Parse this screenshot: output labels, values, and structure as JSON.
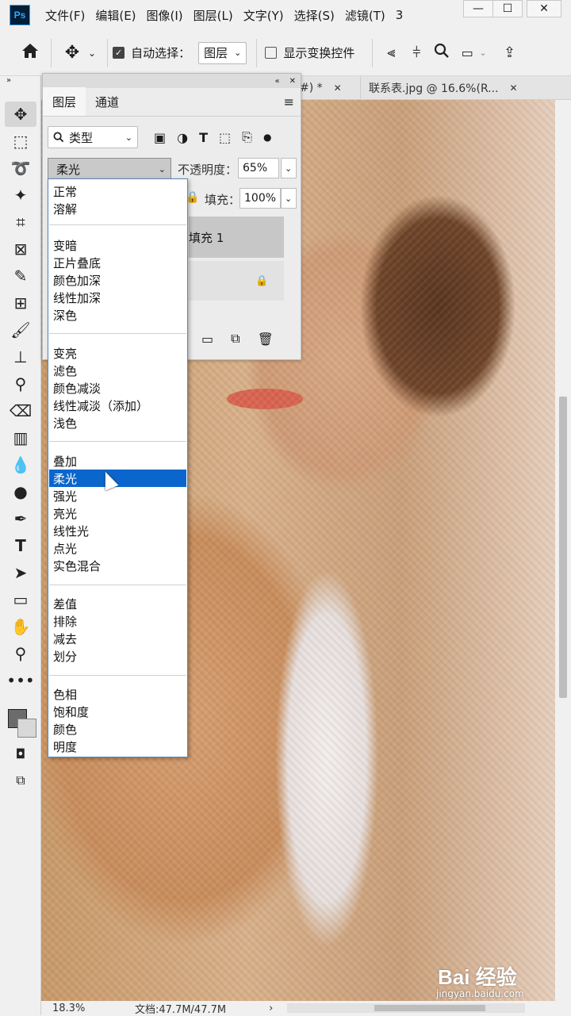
{
  "app": {
    "logo_text": "Ps",
    "window_number": "3"
  },
  "menu": [
    "文件(F)",
    "编辑(E)",
    "图像(I)",
    "图层(L)",
    "文字(Y)",
    "选择(S)",
    "滤镜(T)"
  ],
  "window_controls": {
    "minimize": "—",
    "maximize": "☐",
    "close": "✕"
  },
  "options_bar": {
    "auto_select_label": "自动选择：",
    "auto_select_checked": true,
    "auto_select_value": "图层",
    "show_transform_label": "显示变换控件",
    "show_transform_checked": false
  },
  "doc_tabs": [
    {
      "label": "#) *",
      "close": "✕"
    },
    {
      "label": "联系表.jpg @ 16.6%(R...",
      "close": "✕"
    }
  ],
  "layers_panel": {
    "tabs": [
      "图层",
      "通道"
    ],
    "filter_label": "类型",
    "blend_mode": "柔光",
    "opacity_label": "不透明度：",
    "opacity_value": "65%",
    "fill_label": "填充：",
    "fill_value": "100%",
    "layer_name": "填充 1"
  },
  "blend_menu": {
    "groups": [
      [
        "正常",
        "溶解"
      ],
      [
        "变暗",
        "正片叠底",
        "颜色加深",
        "线性加深",
        "深色"
      ],
      [
        "变亮",
        "滤色",
        "颜色减淡",
        "线性减淡（添加）",
        "浅色"
      ],
      [
        "叠加",
        "柔光",
        "强光",
        "亮光",
        "线性光",
        "点光",
        "实色混合"
      ],
      [
        "差值",
        "排除",
        "减去",
        "划分"
      ],
      [
        "色相",
        "饱和度",
        "颜色",
        "明度"
      ]
    ],
    "selected": "柔光"
  },
  "status_bar": {
    "zoom": "18.3%",
    "doc_info": "文档:47.7M/47.7M",
    "arrow": "›"
  },
  "watermark": {
    "brand": "Bai 经验",
    "url": "jingyan.baidu.com"
  },
  "colors": {
    "selection": "#0a66cc",
    "ps_dark": "#001e36",
    "ps_blue": "#31a8ff"
  }
}
